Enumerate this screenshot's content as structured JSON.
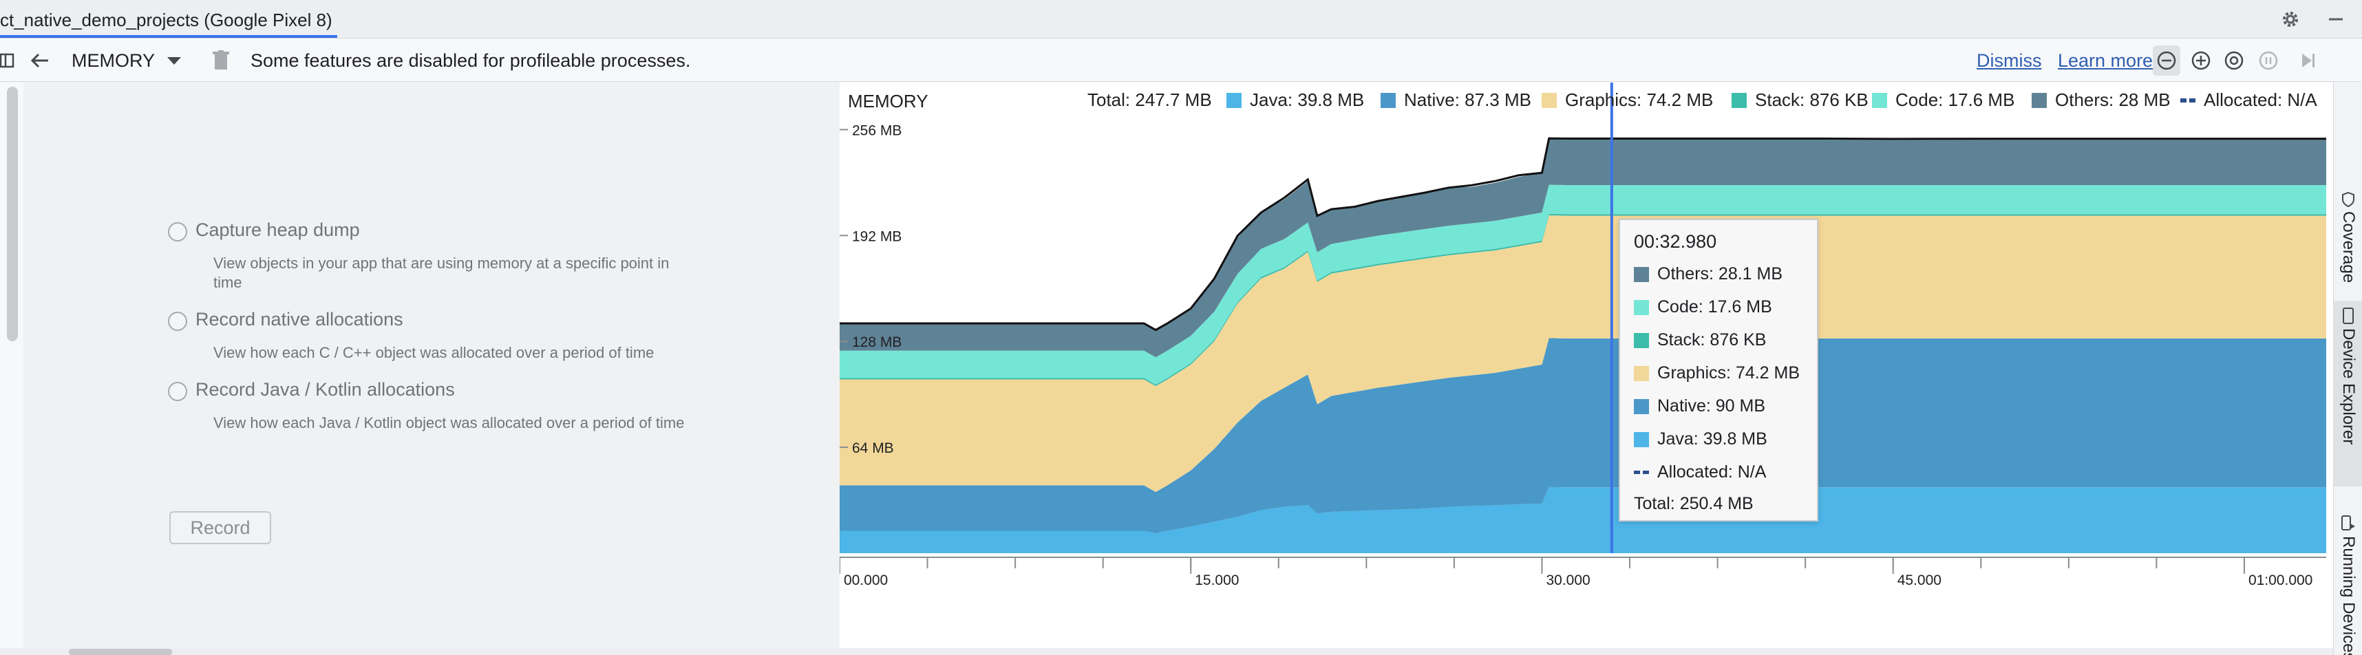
{
  "window": {
    "tab_title": "ct_native_demo_projects (Google Pixel 8)"
  },
  "toolbar": {
    "profiler_select": "MEMORY",
    "banner": "Some features are disabled for profileable processes.",
    "dismiss": "Dismiss",
    "learn_more": "Learn more"
  },
  "options": [
    {
      "label": "Capture heap dump",
      "desc": "View objects in your app that are using memory at a specific point in time"
    },
    {
      "label": "Record native allocations",
      "desc": "View how each C / C++ object was allocated over a period of time"
    },
    {
      "label": "Record Java / Kotlin allocations",
      "desc": "View how each Java / Kotlin object was allocated over a period of time"
    }
  ],
  "record_button": "Record",
  "side_tabs": [
    "Coverage",
    "Device Explorer",
    "Running Devices"
  ],
  "colors": {
    "java": "#4db5e8",
    "native": "#4a98c8",
    "graphics": "#f2d898",
    "stack": "#3cbcab",
    "code": "#74e6d6",
    "others": "#5f8396",
    "cursor": "#3e73e6",
    "accent": "#3574f0"
  },
  "chart_data": {
    "type": "area",
    "title": "MEMORY",
    "legend": {
      "total": "Total: 247.7 MB",
      "items": [
        {
          "key": "java",
          "label": "Java: 39.8 MB"
        },
        {
          "key": "native",
          "label": "Native: 87.3 MB"
        },
        {
          "key": "graphics",
          "label": "Graphics: 74.2 MB"
        },
        {
          "key": "stack",
          "label": "Stack: 876 KB"
        },
        {
          "key": "code",
          "label": "Code: 17.6 MB"
        },
        {
          "key": "others",
          "label": "Others: 28 MB"
        }
      ],
      "allocated": "Allocated: N/A"
    },
    "y_ticks": [
      {
        "v": 64,
        "label": "64 MB"
      },
      {
        "v": 128,
        "label": "128 MB"
      },
      {
        "v": 192,
        "label": "192 MB"
      },
      {
        "v": 256,
        "label": "256 MB"
      }
    ],
    "ylim": [
      0,
      257
    ],
    "x_ticks": [
      {
        "v": 0,
        "label": "00.000"
      },
      {
        "v": 15,
        "label": "15.000"
      },
      {
        "v": 30,
        "label": "30.000"
      },
      {
        "v": 45,
        "label": "45.000"
      },
      {
        "v": 60,
        "label": "01:00.000"
      }
    ],
    "xlim": [
      0,
      63.5
    ],
    "x": [
      0,
      13,
      13.5,
      14,
      15,
      16,
      17,
      18,
      19,
      20,
      20.4,
      21,
      22,
      23,
      25,
      26,
      27,
      28,
      29,
      30,
      30.3,
      31,
      32,
      33,
      34,
      36,
      38,
      40,
      42,
      45,
      50,
      55,
      60,
      63.5
    ],
    "series": [
      {
        "key": "java",
        "values": [
          13.5,
          13.5,
          12,
          13.5,
          16,
          19,
          22,
          26,
          28,
          29,
          24,
          25,
          25.5,
          26,
          27,
          28,
          28.5,
          29,
          29.5,
          30,
          40,
          39.8,
          39.8,
          39.8,
          39.8,
          39.8,
          39.8,
          39.8,
          39.8,
          39.8,
          39.8,
          39.8,
          39.8,
          39.8
        ]
      },
      {
        "key": "native",
        "values": [
          27.5,
          27.5,
          25,
          27.5,
          34,
          44,
          57,
          66,
          72,
          79,
          66,
          70,
          72,
          74,
          77,
          78,
          79,
          80,
          82,
          84,
          90,
          90,
          90,
          90,
          90,
          90,
          90,
          90,
          90,
          90,
          90,
          90,
          90,
          90
        ]
      },
      {
        "key": "graphics",
        "values": [
          64,
          64,
          64,
          64,
          64,
          65,
          72,
          74,
          72,
          74,
          74,
          74,
          74,
          74,
          74,
          74,
          74,
          74,
          74,
          74,
          74.2,
          74.2,
          74.2,
          74.2,
          74.2,
          74.2,
          74.2,
          74.2,
          74.2,
          74.2,
          74.2,
          74.2,
          74.2,
          74.2
        ]
      },
      {
        "key": "stack",
        "values": [
          0.9,
          0.9,
          0.9,
          0.9,
          0.9,
          0.9,
          0.9,
          0.9,
          0.9,
          0.9,
          0.9,
          0.9,
          0.9,
          0.9,
          0.9,
          0.9,
          0.9,
          0.9,
          0.9,
          0.9,
          0.9,
          0.9,
          0.9,
          0.9,
          0.9,
          0.9,
          0.9,
          0.9,
          0.9,
          0.9,
          0.9,
          0.9,
          0.9,
          0.9
        ]
      },
      {
        "key": "code",
        "values": [
          16.5,
          16.5,
          16.5,
          16.5,
          16.5,
          17,
          17,
          17,
          17,
          17,
          17,
          17,
          17,
          17,
          17,
          17,
          17,
          17,
          17,
          17,
          17.6,
          17.6,
          17.6,
          17.6,
          17.6,
          17.6,
          17.6,
          17.6,
          17.6,
          17.6,
          17.6,
          17.6,
          17.6,
          17.6
        ]
      },
      {
        "key": "others",
        "values": [
          16.5,
          16.5,
          16.5,
          16.5,
          16.5,
          20,
          22,
          22,
          24,
          25,
          22,
          21,
          20,
          21,
          22,
          23,
          22,
          23,
          24,
          24,
          28,
          28.1,
          28.1,
          28.1,
          28.1,
          28.1,
          28.1,
          28.1,
          28.1,
          28.1,
          28,
          28,
          28,
          28
        ]
      }
    ],
    "total_line": [
      138.9,
      138.9,
      134.9,
      138.9,
      147.9,
      165.9,
      191.9,
      205.9,
      214.9,
      225.9,
      203.9,
      207.9,
      209.4,
      212.9,
      217.9,
      220.9,
      222.4,
      224.9,
      228.4,
      229.9,
      250.7,
      250.6,
      250.6,
      250.6,
      250.6,
      250.6,
      250.6,
      250.6,
      250.6,
      250.4,
      250.5,
      250.5,
      250.5,
      250.5
    ],
    "cursor_x": 32.98,
    "tooltip": {
      "time": "00:32.980",
      "rows": [
        {
          "key": "others",
          "label": "Others: 28.1 MB"
        },
        {
          "key": "code",
          "label": "Code: 17.6 MB"
        },
        {
          "key": "stack",
          "label": "Stack: 876 KB"
        },
        {
          "key": "graphics",
          "label": "Graphics: 74.2 MB"
        },
        {
          "key": "native",
          "label": "Native: 90 MB"
        },
        {
          "key": "java",
          "label": "Java: 39.8 MB"
        },
        {
          "key": "allocated",
          "label": "Allocated: N/A"
        }
      ],
      "total": "Total: 250.4 MB"
    }
  }
}
